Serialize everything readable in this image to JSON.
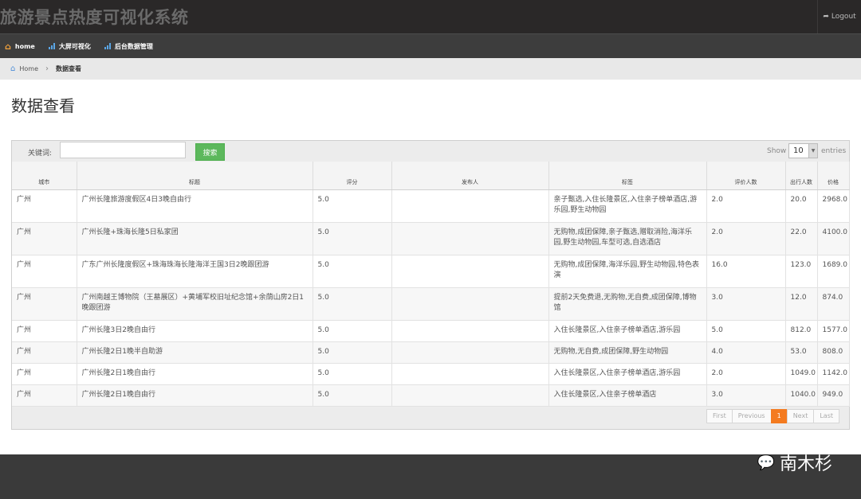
{
  "app": {
    "title": "旅游景点热度可视化系统",
    "logout_label": "Logout"
  },
  "nav": [
    {
      "label": "home"
    },
    {
      "label": "大屏可视化"
    },
    {
      "label": "后台数据管理"
    }
  ],
  "breadcrumb": {
    "home": "Home",
    "current": "数据查看"
  },
  "page_title": "数据查看",
  "search": {
    "label": "关键词:",
    "value": "",
    "placeholder": "",
    "button": "搜索"
  },
  "entries": {
    "show": "Show",
    "value": "10",
    "suffix": "entries"
  },
  "table": {
    "headers": [
      "城市",
      "标题",
      "评分",
      "发布人",
      "标签",
      "评价人数",
      "出行人数",
      "价格"
    ],
    "rows": [
      [
        "广州",
        "广州长隆旅游度假区4日3晚自由行",
        "5.0",
        "",
        "亲子甄选,入住长隆景区,入住亲子榜单酒店,游乐园,野生动物园",
        "2.0",
        "20.0",
        "2968.0"
      ],
      [
        "广州",
        "广州长隆+珠海长隆5日私家团",
        "5.0",
        "",
        "无购物,成团保障,亲子甄选,赠取消险,海洋乐园,野生动物园,车型可选,自选酒店",
        "2.0",
        "22.0",
        "4100.0"
      ],
      [
        "广州",
        "广东广州长隆度假区+珠海珠海长隆海洋王国3日2晚跟团游",
        "5.0",
        "",
        "无购物,成团保障,海洋乐园,野生动物园,特色表演",
        "16.0",
        "123.0",
        "1689.0"
      ],
      [
        "广州",
        "广州南越王博物院（王墓展区）+黄埔军校旧址纪念馆+余荫山房2日1晚跟团游",
        "5.0",
        "",
        "提前2天免费退,无购物,无自费,成团保障,博物馆",
        "3.0",
        "12.0",
        "874.0"
      ],
      [
        "广州",
        "广州长隆3日2晚自由行",
        "5.0",
        "",
        "入住长隆景区,入住亲子榜单酒店,游乐园",
        "5.0",
        "812.0",
        "1577.0"
      ],
      [
        "广州",
        "广州长隆2日1晚半自助游",
        "5.0",
        "",
        "无购物,无自费,成团保障,野生动物园",
        "4.0",
        "53.0",
        "808.0"
      ],
      [
        "广州",
        "广州长隆2日1晚自由行",
        "5.0",
        "",
        "入住长隆景区,入住亲子榜单酒店,游乐园",
        "2.0",
        "1049.0",
        "1142.0"
      ],
      [
        "广州",
        "广州长隆2日1晚自由行",
        "5.0",
        "",
        "入住长隆景区,入住亲子榜单酒店",
        "3.0",
        "1040.0",
        "949.0"
      ]
    ]
  },
  "pagination": {
    "first": "First",
    "previous": "Previous",
    "current": "1",
    "next": "Next",
    "last": "Last"
  },
  "watermark": "南木杉",
  "colors": {
    "accent_green": "#5cb85c",
    "active_page": "#f47b20",
    "topbar": "#2a2828"
  }
}
